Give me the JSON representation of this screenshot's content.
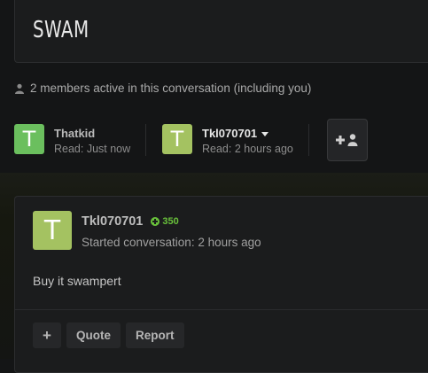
{
  "conversation": {
    "title": "SWAM"
  },
  "active_text": "2 members active in this conversation (including you)",
  "members": [
    {
      "avatar_letter": "T",
      "avatar_color": "#6bbf5e",
      "name": "Thatkid",
      "read": "Read: Just now"
    },
    {
      "avatar_letter": "T",
      "avatar_color": "#a4c261",
      "name": "Tkl070701",
      "read": "Read: 2 hours ago"
    }
  ],
  "add_participant_icon": "plus-user-icon",
  "post": {
    "avatar_letter": "T",
    "avatar_color": "#a4c261",
    "author": "Tkl070701",
    "reputation": "350",
    "started": "Started conversation: 2 hours ago",
    "body": "Buy it swampert"
  },
  "actions": {
    "plus": "+",
    "quote": "Quote",
    "report": "Report"
  }
}
